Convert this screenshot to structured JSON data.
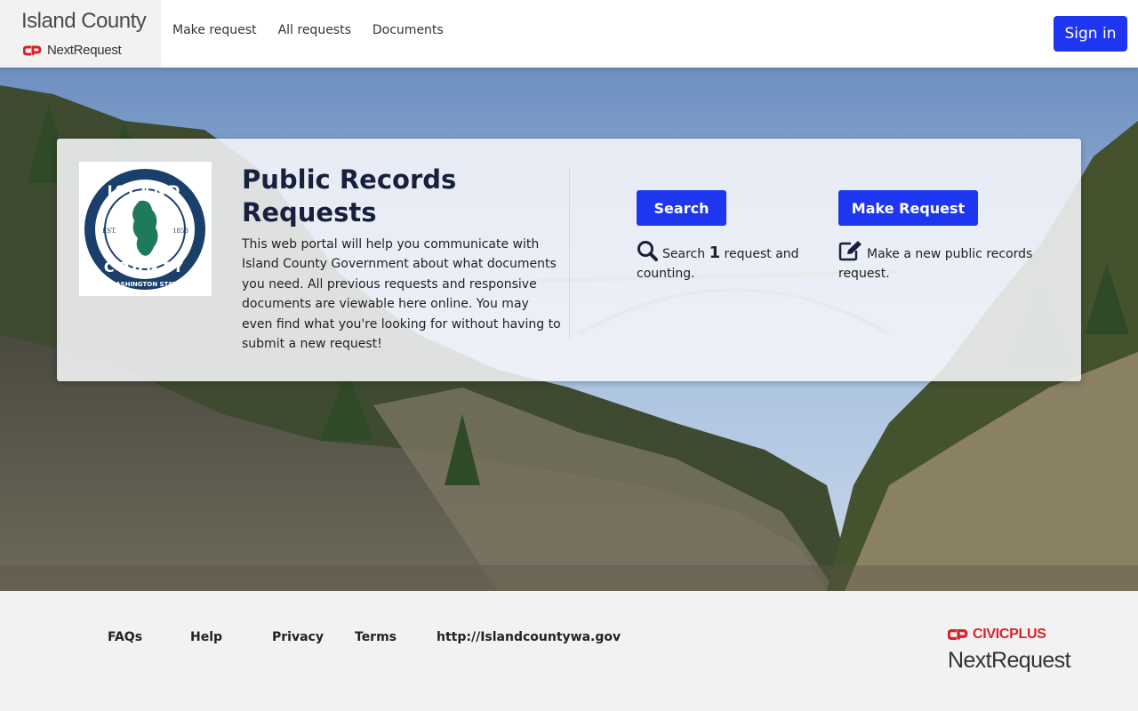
{
  "header": {
    "brand_title": "Island County",
    "brand_sub": "NextRequest",
    "nav": [
      "Make request",
      "All requests",
      "Documents"
    ],
    "signin_label": "Sign in"
  },
  "card": {
    "logo": {
      "top_text": "ISLAND",
      "bottom_text": "COUNTY",
      "est_left": "EST.",
      "est_right": "1853",
      "ring_text": "WASHINGTON STATE"
    },
    "title": "Public Records Requests",
    "description": "This web portal will help you communicate with Island County Government about what documents you need. All previous requests and responsive documents are viewable here online. You may even find what you're looking for without having to submit a new request!",
    "search_button": "Search",
    "search_info_pre": "Search",
    "search_count": "1",
    "search_info_post": "request and counting.",
    "make_button": "Make Request",
    "make_info": "Make a new public records request."
  },
  "footer": {
    "links": [
      "FAQs",
      "Help",
      "Privacy",
      "Terms",
      "http://Islandcountywa.gov"
    ],
    "civicplus": "CIVICPLUS",
    "nextrequest": "NextRequest"
  },
  "colors": {
    "primary": "#1f36f0",
    "title": "#16213e",
    "logo_blue": "#1b3f6b",
    "logo_green": "#1e7a5a",
    "civic_red": "#d8232a"
  },
  "icons": [
    "cp-logo-icon",
    "search-icon",
    "edit-icon"
  ]
}
